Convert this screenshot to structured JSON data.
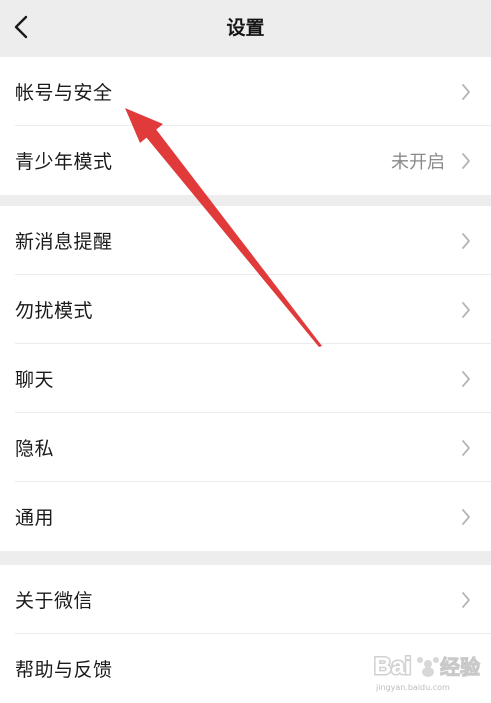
{
  "header": {
    "title": "设置",
    "back_icon": "chevron-left-icon"
  },
  "groups": [
    {
      "items": [
        {
          "label": "帐号与安全",
          "value": ""
        },
        {
          "label": "青少年模式",
          "value": "未开启"
        }
      ]
    },
    {
      "items": [
        {
          "label": "新消息提醒",
          "value": ""
        },
        {
          "label": "勿扰模式",
          "value": ""
        },
        {
          "label": "聊天",
          "value": ""
        },
        {
          "label": "隐私",
          "value": ""
        },
        {
          "label": "通用",
          "value": ""
        }
      ]
    },
    {
      "items": [
        {
          "label": "关于微信",
          "value": ""
        },
        {
          "label": "帮助与反馈",
          "value": ""
        }
      ]
    }
  ],
  "annotation": {
    "arrow_color": "#e03a3a"
  },
  "watermark": {
    "logo_text": "Bai 经验",
    "site": "jingyan.baidu.com"
  },
  "colors": {
    "background": "#ededed",
    "row_background": "#ffffff",
    "chevron": "#b5b5b5",
    "secondary_text": "#8a8a8a"
  }
}
